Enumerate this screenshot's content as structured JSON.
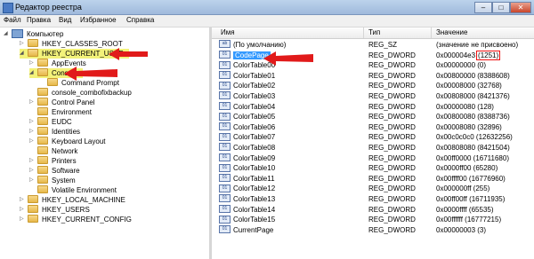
{
  "window": {
    "title": "Редактор реестра",
    "buttons": [
      "–",
      "□",
      "✕"
    ]
  },
  "menu": [
    "Файл",
    "Правка",
    "Вид",
    "Избранное",
    "Справка"
  ],
  "tree": [
    {
      "label": "Компьютер",
      "level": 0,
      "expanded": true
    },
    {
      "label": "HKEY_CLASSES_ROOT",
      "level": 1
    },
    {
      "label": "HKEY_CURRENT_USER",
      "level": 1,
      "expanded": true,
      "highlight": true
    },
    {
      "label": "AppEvents",
      "level": 2
    },
    {
      "label": "Console",
      "level": 2,
      "expanded": true,
      "highlight": true
    },
    {
      "label": "Command Prompt",
      "level": 3
    },
    {
      "label": "console_combofixbackup",
      "level": 2
    },
    {
      "label": "Control Panel",
      "level": 2
    },
    {
      "label": "Environment",
      "level": 2
    },
    {
      "label": "EUDC",
      "level": 2
    },
    {
      "label": "Identities",
      "level": 2
    },
    {
      "label": "Keyboard Layout",
      "level": 2
    },
    {
      "label": "Network",
      "level": 2
    },
    {
      "label": "Printers",
      "level": 2
    },
    {
      "label": "Software",
      "level": 2
    },
    {
      "label": "System",
      "level": 2
    },
    {
      "label": "Volatile Environment",
      "level": 2
    },
    {
      "label": "HKEY_LOCAL_MACHINE",
      "level": 1
    },
    {
      "label": "HKEY_USERS",
      "level": 1
    },
    {
      "label": "HKEY_CURRENT_CONFIG",
      "level": 1
    }
  ],
  "columns": {
    "name": "Имя",
    "type": "Тип",
    "value": "Значение"
  },
  "values": [
    {
      "name": "(По умолчанию)",
      "type": "REG_SZ",
      "value": "(значение не присвоено)",
      "icon": "ab"
    },
    {
      "name": "CodePage",
      "type": "REG_DWORD",
      "value": "0x000004e3",
      "value_extra": "(1251)",
      "icon": "01",
      "selected": true
    },
    {
      "name": "ColorTable00",
      "type": "REG_DWORD",
      "value": "0x00000000 (0)",
      "icon": "01"
    },
    {
      "name": "ColorTable01",
      "type": "REG_DWORD",
      "value": "0x00800000 (8388608)",
      "icon": "01"
    },
    {
      "name": "ColorTable02",
      "type": "REG_DWORD",
      "value": "0x00008000 (32768)",
      "icon": "01"
    },
    {
      "name": "ColorTable03",
      "type": "REG_DWORD",
      "value": "0x00808000 (8421376)",
      "icon": "01"
    },
    {
      "name": "ColorTable04",
      "type": "REG_DWORD",
      "value": "0x00000080 (128)",
      "icon": "01"
    },
    {
      "name": "ColorTable05",
      "type": "REG_DWORD",
      "value": "0x00800080 (8388736)",
      "icon": "01"
    },
    {
      "name": "ColorTable06",
      "type": "REG_DWORD",
      "value": "0x00008080 (32896)",
      "icon": "01"
    },
    {
      "name": "ColorTable07",
      "type": "REG_DWORD",
      "value": "0x00c0c0c0 (12632256)",
      "icon": "01"
    },
    {
      "name": "ColorTable08",
      "type": "REG_DWORD",
      "value": "0x00808080 (8421504)",
      "icon": "01"
    },
    {
      "name": "ColorTable09",
      "type": "REG_DWORD",
      "value": "0x00ff0000 (16711680)",
      "icon": "01"
    },
    {
      "name": "ColorTable10",
      "type": "REG_DWORD",
      "value": "0x0000ff00 (65280)",
      "icon": "01"
    },
    {
      "name": "ColorTable11",
      "type": "REG_DWORD",
      "value": "0x00ffff00 (16776960)",
      "icon": "01"
    },
    {
      "name": "ColorTable12",
      "type": "REG_DWORD",
      "value": "0x000000ff (255)",
      "icon": "01"
    },
    {
      "name": "ColorTable13",
      "type": "REG_DWORD",
      "value": "0x00ff00ff (16711935)",
      "icon": "01"
    },
    {
      "name": "ColorTable14",
      "type": "REG_DWORD",
      "value": "0x0000ffff (65535)",
      "icon": "01"
    },
    {
      "name": "ColorTable15",
      "type": "REG_DWORD",
      "value": "0x00ffffff (16777215)",
      "icon": "01"
    },
    {
      "name": "CurrentPage",
      "type": "REG_DWORD",
      "value": "0x00000003 (3)",
      "icon": "01"
    }
  ],
  "colors": {
    "highlight": "#f3f27a",
    "selection": "#3399ff",
    "arrow": "#e11a1a"
  }
}
